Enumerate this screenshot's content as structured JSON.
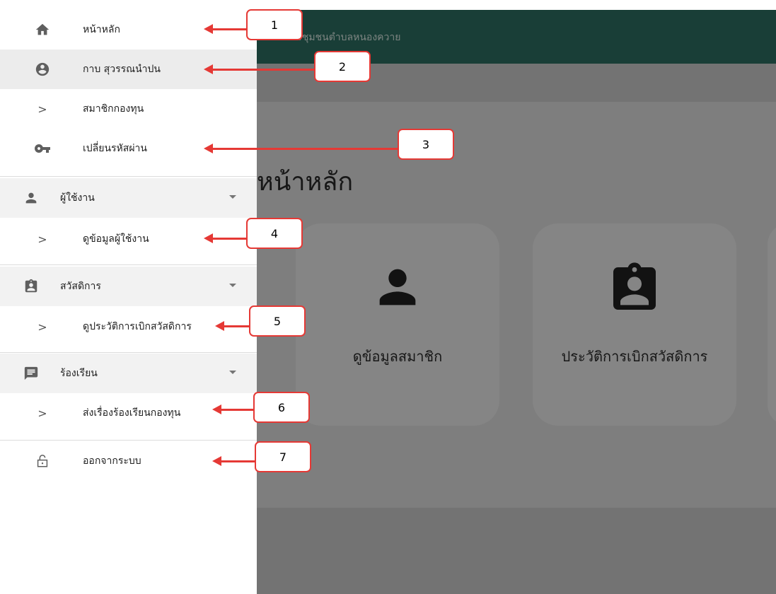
{
  "app": {
    "title": "สวัสดิการชุมชนตำบลหนองควาย",
    "page_heading": "หน้าหลัก",
    "tiles": [
      {
        "label": "ดูข้อมูลสมาชิก",
        "icon": "person-icon"
      },
      {
        "label": "ประวัติการเบิกสวัสดิการ",
        "icon": "badge-icon"
      }
    ]
  },
  "drawer": {
    "home": {
      "label": "หน้าหลัก",
      "icon": "home-icon"
    },
    "account": {
      "label": "กาบ สุวรรณนำปน",
      "icon": "account-circle-icon"
    },
    "members": {
      "label": "สมาชิกกองทุน",
      "icon": "chevron-right-icon"
    },
    "change_password": {
      "label": "เปลี่ยนรหัสผ่าน",
      "icon": "key-icon"
    },
    "users_group": {
      "label": "ผู้ใช้งาน",
      "icon": "person-icon"
    },
    "view_users": {
      "label": "ดูข้อมูลผู้ใช้งาน",
      "icon": "chevron-right-icon"
    },
    "welfare_group": {
      "label": "สวัสดิการ",
      "icon": "badge-icon"
    },
    "welfare_history": {
      "label": "ดูประวัติการเบิกสวัสดิการ",
      "icon": "chevron-right-icon"
    },
    "complaint_group": {
      "label": "ร้องเรียน",
      "icon": "chat-icon"
    },
    "send_complaint": {
      "label": "ส่งเรื่องร้องเรียนกองทุน",
      "icon": "chevron-right-icon"
    },
    "logout": {
      "label": "ออกจากระบบ",
      "icon": "unlock-icon"
    }
  },
  "callouts": [
    "1",
    "2",
    "3",
    "4",
    "5",
    "6",
    "7"
  ],
  "colors": {
    "annotation_red": "#e53935",
    "app_bar": "#2e7265"
  }
}
